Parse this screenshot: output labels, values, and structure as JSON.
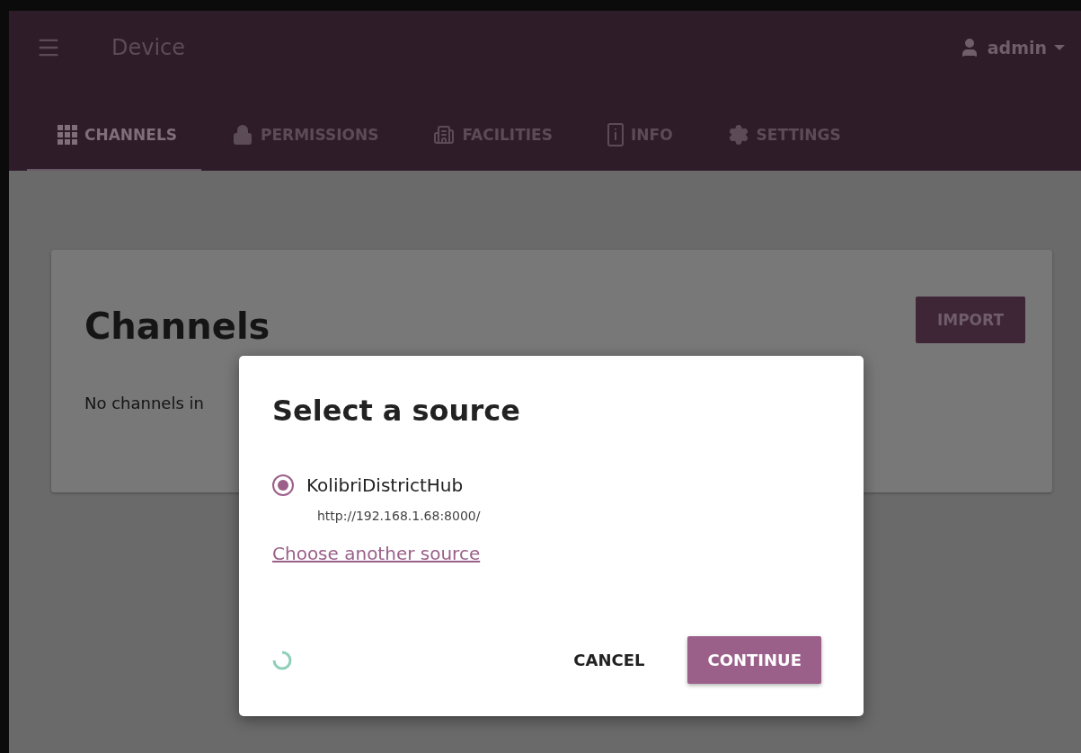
{
  "header": {
    "title": "Device",
    "user": "admin"
  },
  "tabs": [
    {
      "label": "CHANNELS",
      "selected": true
    },
    {
      "label": "PERMISSIONS",
      "selected": false
    },
    {
      "label": "FACILITIES",
      "selected": false
    },
    {
      "label": "INFO",
      "selected": false
    },
    {
      "label": "SETTINGS",
      "selected": false
    }
  ],
  "card": {
    "title": "Channels",
    "import_button": "IMPORT",
    "empty_text": "No channels in"
  },
  "dialog": {
    "title": "Select a source",
    "sources": [
      {
        "name": "KolibriDistrictHub",
        "url": "http://192.168.1.68:8000/",
        "selected": true
      }
    ],
    "link": "Choose another source",
    "loading": true,
    "cancel": "CANCEL",
    "continue": "CONTINUE"
  }
}
